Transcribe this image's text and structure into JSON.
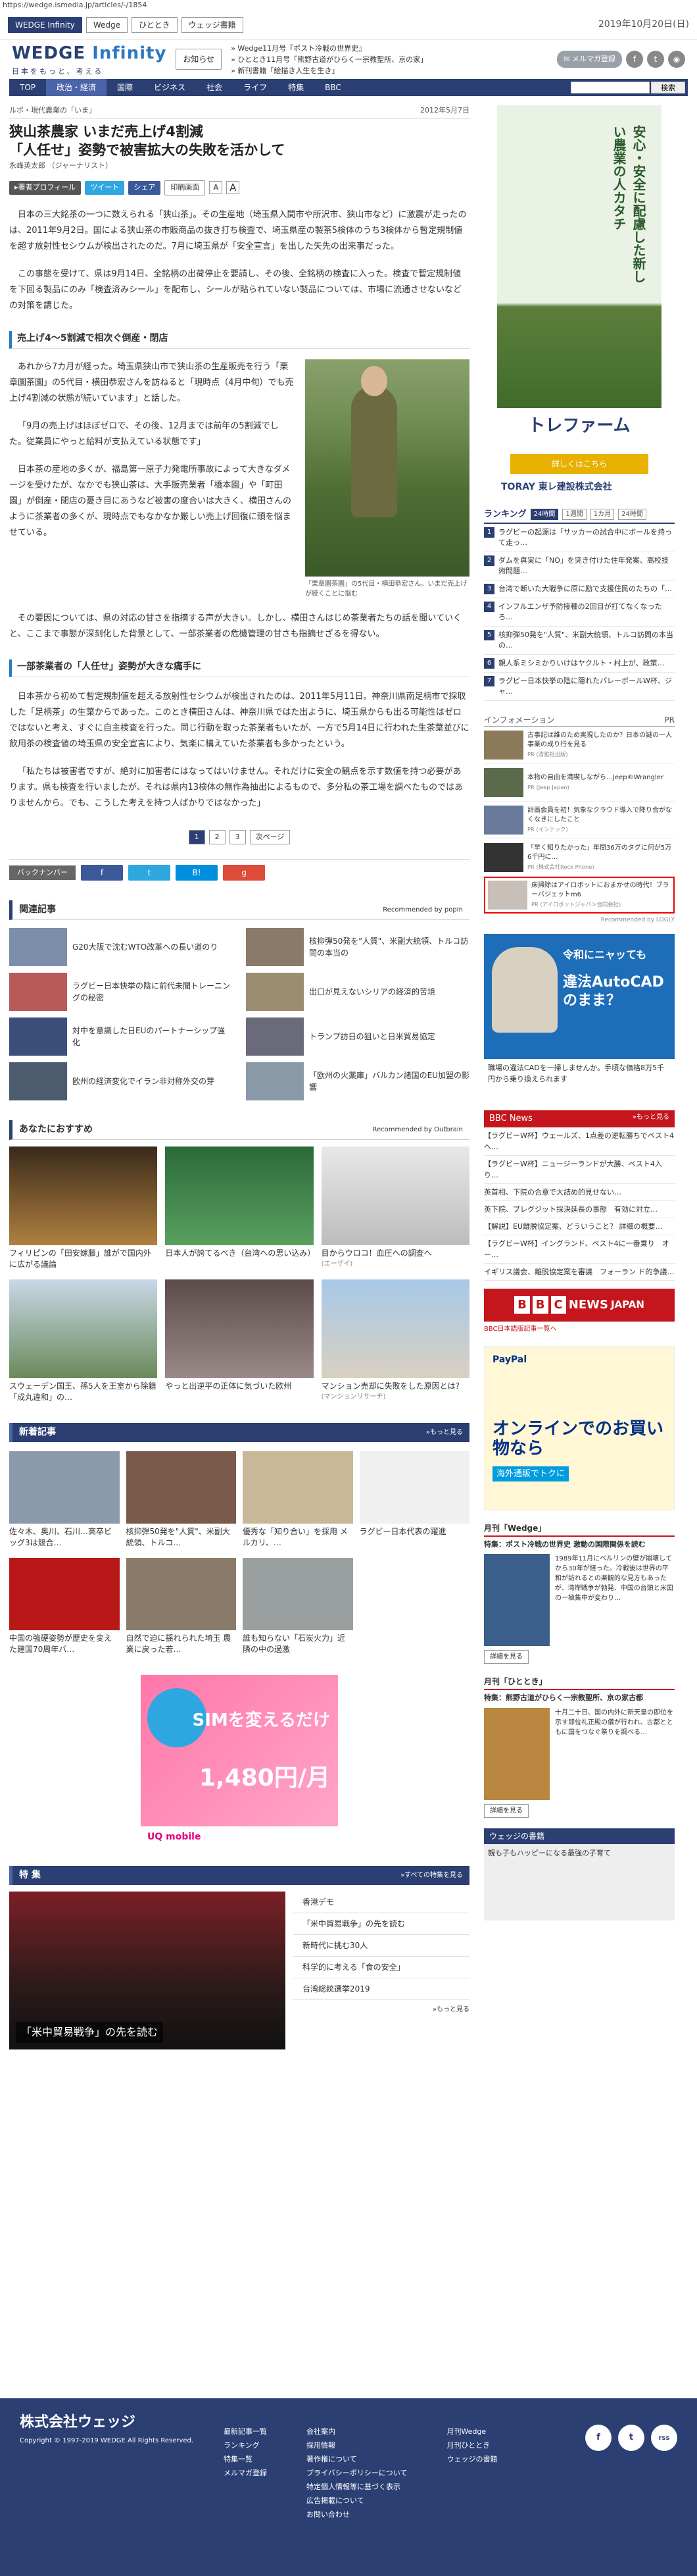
{
  "url": "https://wedge.ismedia.jp/articles/-/1854",
  "topstrip": {
    "sites": [
      "WEDGE Infinity",
      "Wedge",
      "ひととき",
      "ウェッジ書籍"
    ],
    "date": "2019年10月20日(日)"
  },
  "header": {
    "logo_main": "WEDGE",
    "logo_sub": "Infinity",
    "tagline": "日本をもっと、考える",
    "notice": "お知らせ",
    "news": [
      "Wedge11月号『ポスト冷戦の世界史』",
      "ひととき11月号「熊野古道がひらく一宗教聖所、京の家」",
      "新刊書籍「絵描き人生を生き」"
    ],
    "mailmag": "メルマガ登録"
  },
  "nav": {
    "items": [
      "TOP",
      "政治・経済",
      "国際",
      "ビジネス",
      "社会",
      "ライフ",
      "特集",
      "BBC"
    ],
    "search_label": "検索"
  },
  "article": {
    "crumb": "ルポ・現代農業の「いま」",
    "date": "2012年5月7日",
    "title_l1": "狭山茶農家 いまだ売上げ4割減",
    "title_l2": "「人任せ」姿勢で被害拡大の失敗を活かして",
    "author": "永峰英太郎 （ジャーナリスト）",
    "profile_btn": "著者プロフィール",
    "tweet_btn": "ツイート",
    "share_btn": "シェア",
    "print_btn": "印刷画面",
    "font_s": "A",
    "font_l": "A",
    "p1": "日本の三大銘茶の一つに数えられる「狭山茶」。その生産地（埼玉県入間市や所沢市、狭山市など）に激震が走ったのは、2011年9月2日。国による狭山茶の市販商品の抜き打ち検査で、埼玉県産の製茶5検体のうち3検体から暫定規制値を超す放射性セシウムが検出されたのだ。7月に埼玉県が「安全宣言」を出した矢先の出来事だった。",
    "p2": "この事態を受けて、県は9月14日、全銘柄の出荷停止を要請し、その後、全銘柄の検査に入った。検査で暫定規制値を下回る製品にのみ「検査済みシール」を配布し、シールが貼られていない製品については、市場に流通させないなどの対策を講じた。",
    "h2_1": "売上げ4～5割減で相次ぐ倒産・閉店",
    "p3": "あれから7カ月が経った。埼玉県狭山市で狭山茶の生産販売を行う「栗章園茶園」の5代目・横田恭宏さんを訪ねると「現時点（4月中旬）でも売上げ4割減の状態が続いています」と話した。",
    "p4": "「9月の売上げはほぼゼロで、その後、12月までは前年の5割減でした。従業員にやっと給料が支払えている状態です」",
    "p5": "日本茶の産地の多くが、福島第一原子力発電所事故によって大きなダメージを受けたが、なかでも狭山茶は、大手販売業者「橋本園」や「町田園」が倒産・閉店の憂き目にあうなど被害の度合いは大きく、横田さんのように茶業者の多くが、現時点でもなかなか厳しい売上げ回復に頭を悩ませている。",
    "fig_caption": "「栗章園茶園」の5代目・横田恭宏さん。いまだ売上げが続くことに悩む",
    "p6": "その要因については、県の対応の甘さを指摘する声が大きい。しかし、横田さんはじめ茶業者たちの話を聞いていくと、ここまで事態が深刻化した背景として、一部茶業者の危機管理の甘さも指摘せざるを得ない。",
    "h2_2": "一部茶業者の「人任せ」姿勢が大きな痛手に",
    "p7": "日本茶から初めて暫定規制値を超える放射性セシウムが検出されたのは、2011年5月11日。神奈川県南足柄市で採取した「足柄茶」の生葉からであった。このとき横田さんは、神奈川県ではた出ように、埼玉県からも出る可能性はゼロではないと考え、すぐに自主検査を行った。同じ行動を取った茶業者もいたが、一方で5月14日に行われた生茶葉並びに飲用茶の検査値の埼玉県の安全宣言により、気楽に構えていた茶業者も多かったという。",
    "p8": "「私たちは被害者ですが、絶対に加害者にはなってはいけません。それだけに安全の観点を示す数値を持つ必要があります。県も検査を行いましたが、それは県内13検体の無作為抽出によるもので、多分私の茶工場を調べたものではありませんから。でも、こうした考えを持つ人ばかりではなかった」",
    "pager": [
      "1",
      "2",
      "3",
      "次ページ"
    ],
    "backnumber": "バックナンバー",
    "share_icons": [
      "f",
      "t",
      "B!",
      "g"
    ]
  },
  "related": {
    "title": "関連記事",
    "by": "Recommended by popIn",
    "items": [
      "G20大阪で沈むWTO改革への長い道のり",
      "核抑弾50発を\"人質\"、米副大統領、トルコ訪問の本当の",
      "ラグビー日本快挙の陰に前代未聞トレーニングの秘密",
      "出口が見えないシリアの経済的苦境",
      "対中を意識した日EUのパートナーシップ強化",
      "トランプ訪日の狙いと日米貿易協定",
      "欧州の経済変化でイラン非対称外交の芽",
      "「欧州の火薬庫」バルカン諸国のEU加盟の影響"
    ]
  },
  "recs": {
    "title": "あなたにおすすめ",
    "by": "Recommended by Outbrain",
    "items": [
      {
        "t": "フィリピンの「田安嫁藤」誰がで国内外に広がる議論",
        "s": ""
      },
      {
        "t": "日本人が誇てるべき（台湾への思い込み）",
        "s": ""
      },
      {
        "t": "目からウロコ！血圧への調査へ",
        "s": "(エーザイ)"
      },
      {
        "t": "スウェーデン国王、孫5人を王室から除籍 「成丸違和」の…",
        "s": ""
      },
      {
        "t": "やっと出逆平の正体に気づいた欧州",
        "s": ""
      },
      {
        "t": "マンション売却に失敗をした原因とは？",
        "s": "(マンションリサーチ)"
      }
    ]
  },
  "news_new": {
    "title": "新着記事",
    "more": "»もっと見る",
    "items": [
      "佐々木、奥川、石川…高卒ビッグ3は競合…",
      "核抑弾50発を\"人質\"、米副大統領、トルコ…",
      "優秀な「知り合い」を採用 メルカリ、…",
      "ラグビー日本代表の躍進",
      "中国の強硬姿勢が歴史を変えた建国70周年パ…",
      "自然で迫に揺れられた埼玉 農業に戻った若…",
      "誰も知らない「石炭火力」近隣の中の過激",
      ""
    ]
  },
  "uq_ad": {
    "t1": "SIMを変えるだけ",
    "t2": "1,480円/月",
    "brand": "UQ mobile"
  },
  "tokushu": {
    "title": "特 集",
    "more": "»すべての特集を見る",
    "photo_label": "「米中貿易戦争」の先を読む",
    "items": [
      "香港デモ",
      "「米中貿易戦争」の先を読む",
      "新時代に挑む30人",
      "科学的に考える「食の安全」",
      "台湾総統選挙2019"
    ],
    "more2": "»もっと見る"
  },
  "footer": {
    "company": "株式会社ウェッジ",
    "copyright": "Copyright © 1997-2019 WEDGE All Rights Reserved.",
    "col1": [
      "最新記事一覧",
      "ランキング",
      "特集一覧",
      "メルマガ登録"
    ],
    "col2": [
      "会社案内",
      "採用情報",
      "著作権について",
      "プライバシーポリシーについて",
      "特定個人情報等に基づく表示",
      "広告掲載について",
      "お問い合わせ"
    ],
    "col3": [
      "月刊Wedge",
      "月刊ひととき",
      "ウェッジの書籍"
    ],
    "sns": [
      "f",
      "t",
      "rss"
    ]
  },
  "side": {
    "ad1_text": "安心・安全に配慮した新しい農業の人カタチ",
    "ad1_brand": "トレファーム",
    "ad1_btn": "詳しくはこちら",
    "ad1_toray": "TORAY 東レ建設株式会社",
    "rank_title": "ランキング",
    "rank_tabs": [
      "24時間",
      "1週間",
      "1カ月",
      "24時間"
    ],
    "ranking": [
      "ラグビーの起源は「サッカーの試合中にボールを持って走っ…",
      "ダムを真実に「NO」を突き付けた住年発案、高校技術問題…",
      "台湾で断いた大戦争に原に励で支援住民のたちの「…",
      "インフルエンザ予防接種の2回目が打てなくなったろ…",
      "核抑弾50発を\"人質\"、米副大統領、トルコ訪問の本当の…",
      "親人系ミシミかりいけはヤクルト・村上が、政策…",
      "ラグビー日本快挙の陰に隠れたパレーボールW杯、ジャ…"
    ],
    "info_title": "インフォメーション",
    "info_pr": "PR",
    "info": [
      {
        "t": "古事記は誰のため実現したのか？日本の謎の一人事業の成り行を見る",
        "s": "PR (清雅社出版)"
      },
      {
        "t": "本物の自由を満喫しながら…Jeep®Wrangler",
        "s": "PR (Jeep Japan)"
      },
      {
        "t": "計画会員を初！気象なクラウド導入で降り合がなくなきにしたこと",
        "s": "PR (インテック)"
      },
      {
        "t": "「早く知りたかった」年間36万のタグに何が5万6千円に…",
        "s": "PR (株式会社Rock Phone)"
      },
      {
        "t": "床掃除はアイロボットにおまかせの時代！ブラーバジェットm6",
        "s": "PR (アイロボットジャパン合同会社)"
      }
    ],
    "info_by": "Recommended by LOGLY",
    "ad2_t1": "令和にニャッても",
    "ad2_t2": "違法AutoCADのまま？",
    "ad2_bar": "職場の違法CADを一掃しませんか。手頃な価格8万5千円から乗り換えられます",
    "bbc_title": "BBC News",
    "bbc_more": "»もっと見る",
    "bbc": [
      "【ラグビーW杯】ウェールズ、1点差の逆転勝ちでベスト4へ…",
      "【ラグビーW杯】ニュージーランドが大勝、ベスト4入り…",
      "英首相、下院の合意で大詰め的見せない…",
      "英下院、ブレグジット採決延長の事態　有効に対立…",
      "【解説】EU離脱協定案、どういうこと？ 詳細の概要…",
      "【ラグビーW杯】イングランド、ベスト4に一番乗り　オー…",
      "イギリス議会、離脱協定案を審議　フォーラン ド的争議…"
    ],
    "bbc_logo": [
      "B",
      "B",
      "C",
      "NEWS",
      "JAPAN"
    ],
    "bbc_link": "BBC日本語版記事一覧へ",
    "ad3_brand": "PayPal",
    "ad3_t1": "オンラインでのお買い物なら",
    "ad3_t2": "海外通販でトクに",
    "mag_title": "月刊「Wedge」",
    "mag_sub": "特集：ポスト冷戦の世界史 激動の国際関係を読む",
    "mag_desc": "1989年11月にベルリンの壁が崩壊してから30年が経った。冷戦後は世界の平和が訪れるとの楽観的な見方もあったが、湾岸戦争が勃発、中国の台頭と米国の一極集中が変わり…",
    "mag_btn": "詳細を見る",
    "mag2_title": "月刊「ひととき」",
    "mag2_sub": "特集：熊野古道がひらく一宗教聖所、京の家古都",
    "mag2_desc": "十月二十日、国の内外に新天皇の即位を示す即位礼正殿の儀が行われ、古都とともに国をつなぐ祭りを調べる…",
    "mag2_btn": "詳細を見る",
    "ad4_title": "ウェッジの書籍",
    "ad4_desc": "親も子もハッピーになる最強の子育て"
  }
}
